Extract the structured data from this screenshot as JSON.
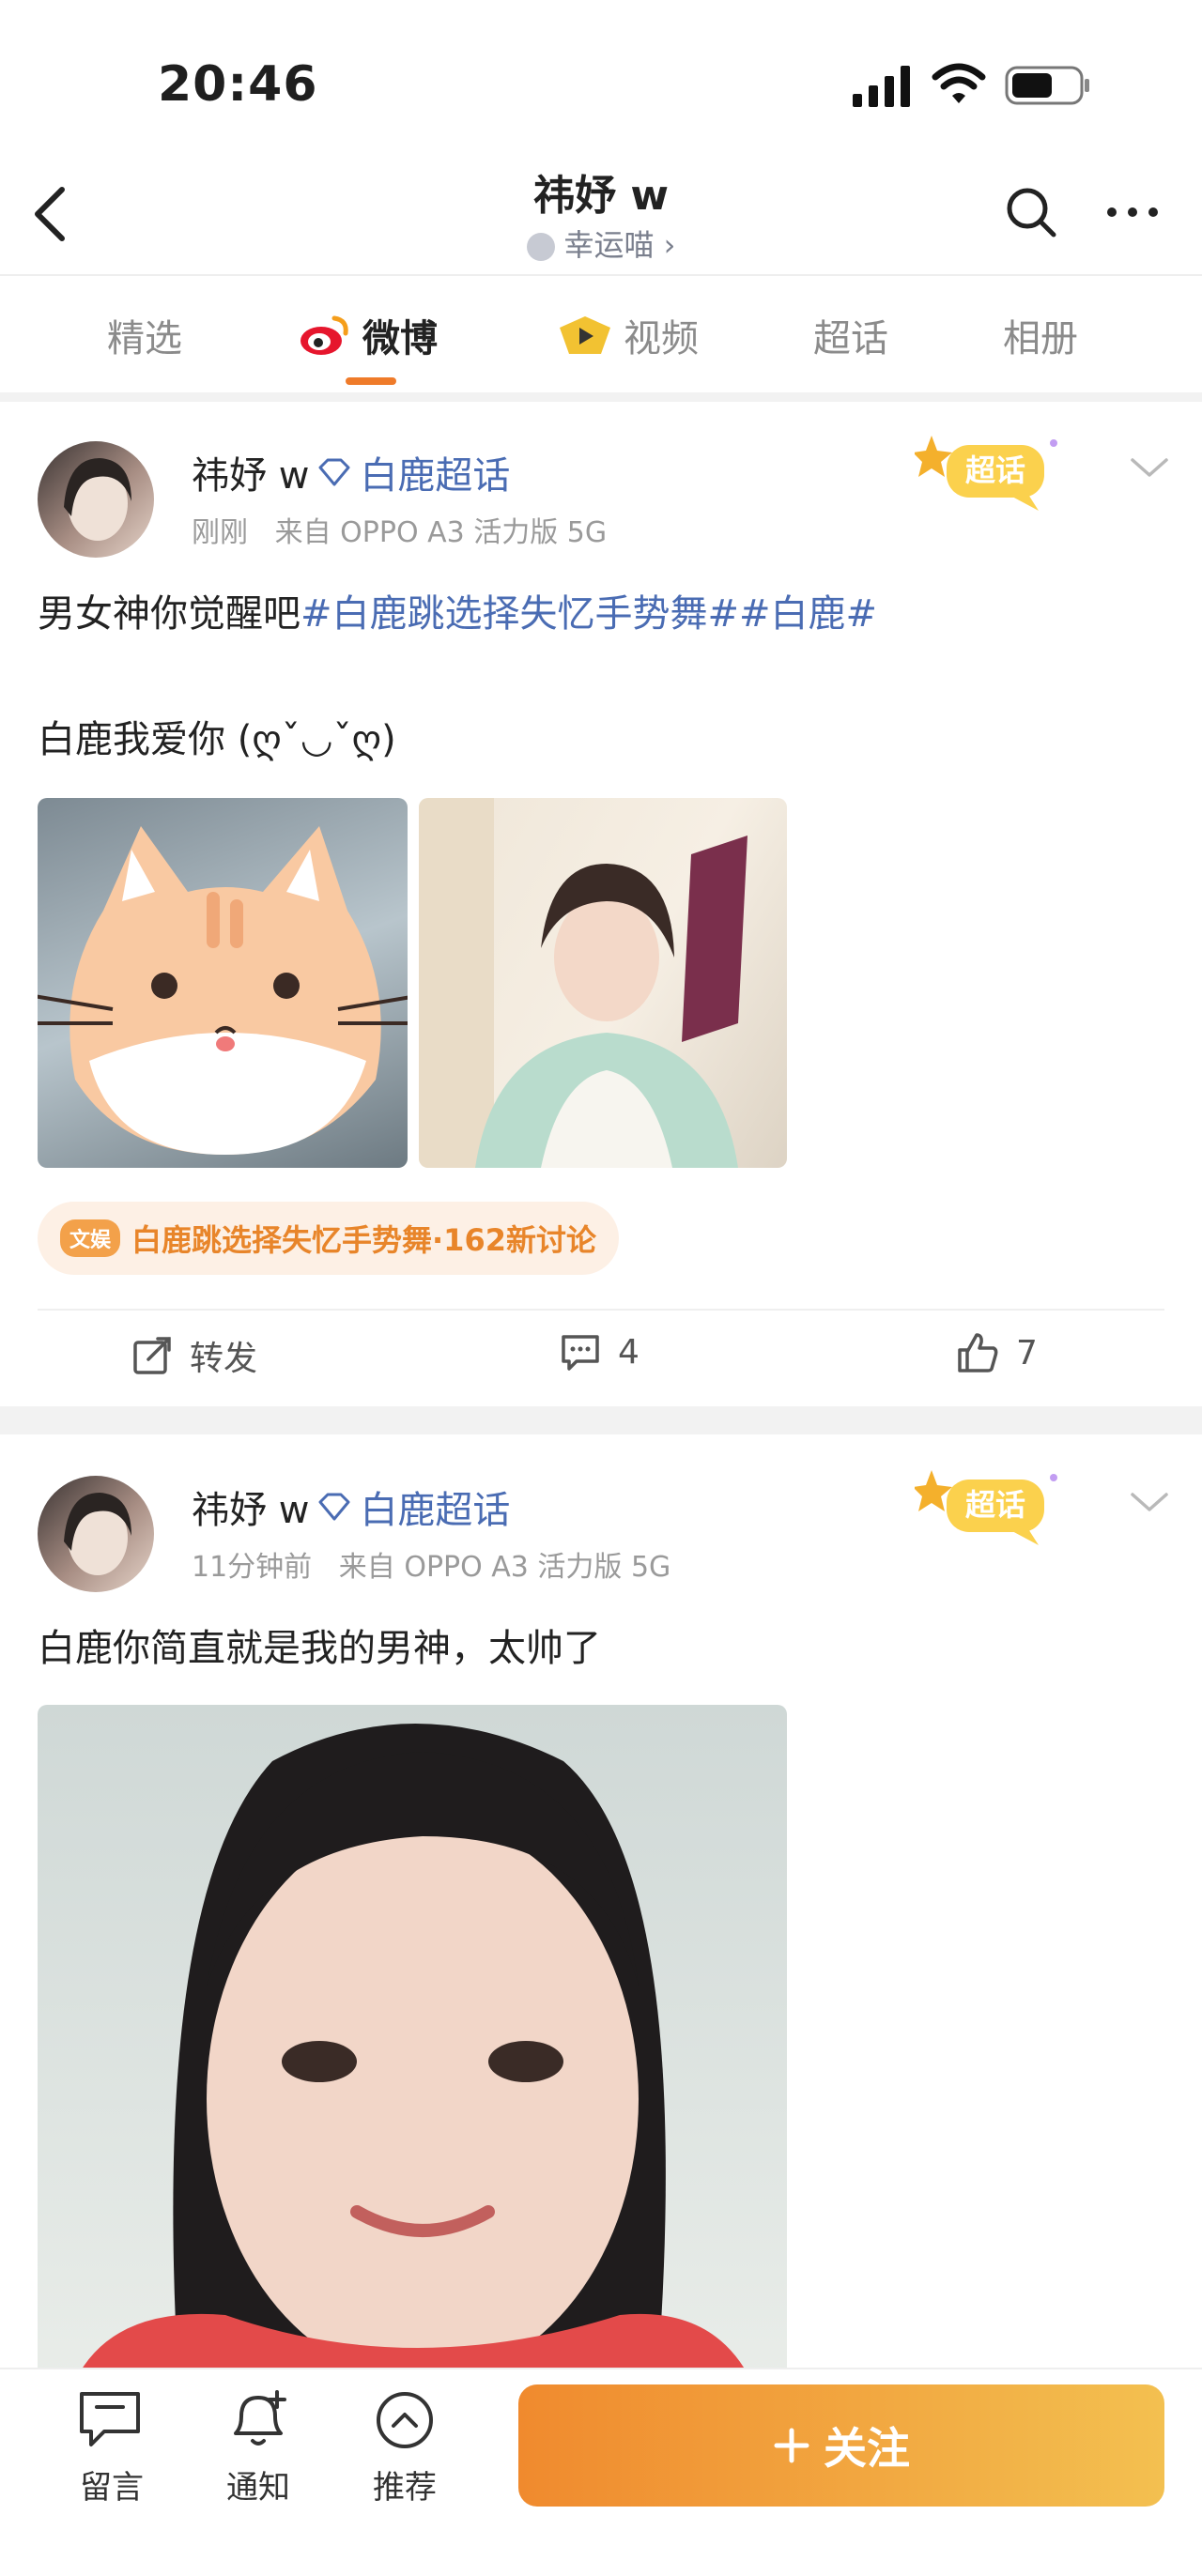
{
  "status_bar": {
    "time": "20:46"
  },
  "header": {
    "title": "祎妤 w",
    "subtitle": "幸运喵 ›"
  },
  "tabs": [
    {
      "label": "精选",
      "active": false
    },
    {
      "label": "微博",
      "active": true
    },
    {
      "label": "视频",
      "active": false
    },
    {
      "label": "超话",
      "active": false
    },
    {
      "label": "相册",
      "active": false
    }
  ],
  "posts": [
    {
      "author": "祎妤 w",
      "topic": "白鹿超话",
      "time": "刚刚",
      "source": "来自 OPPO A3 活力版 5G",
      "badge": "超话",
      "text_plain": "男女神你觉醒吧",
      "text_hashtags": "#白鹿跳选择失忆手势舞##白鹿#",
      "text_line2": "白鹿我爱你 (ღˇ◡ˇღ)",
      "pill_badge": "文娱",
      "pill_text": "白鹿跳选择失忆手势舞·162新讨论",
      "repost_label": "转发",
      "comment_count": "4",
      "like_count": "7"
    },
    {
      "author": "祎妤 w",
      "topic": "白鹿超话",
      "time": "11分钟前",
      "source": "来自 OPPO A3 活力版 5G",
      "badge": "超话",
      "text": "白鹿你简直就是我的男神，太帅了"
    }
  ],
  "bottom_bar": {
    "message_label": "留言",
    "notify_label": "通知",
    "recommend_label": "推荐",
    "follow_label": "关注"
  },
  "colors": {
    "accent": "#ef7b2a",
    "link": "#4a6cb3"
  }
}
